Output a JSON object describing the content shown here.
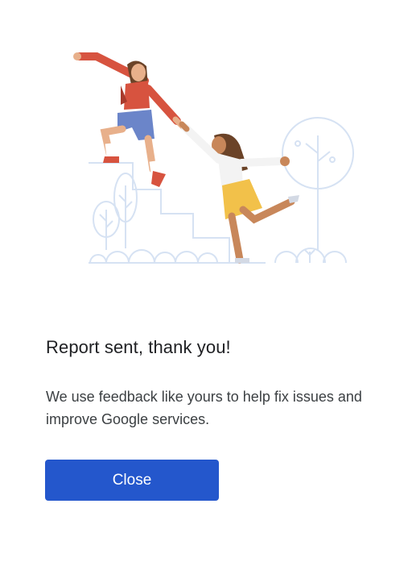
{
  "dialog": {
    "title": "Report sent, thank you!",
    "message": "We use feedback like yours to help fix issues and improve Google services.",
    "close_label": "Close"
  },
  "colors": {
    "button": "#2457cc",
    "illustration_line": "#d6e2f3",
    "shirt_red": "#d7533f",
    "shorts_blue": "#6b85c9",
    "skirt_yellow": "#f2c14a",
    "hair_brown": "#6b4328"
  }
}
